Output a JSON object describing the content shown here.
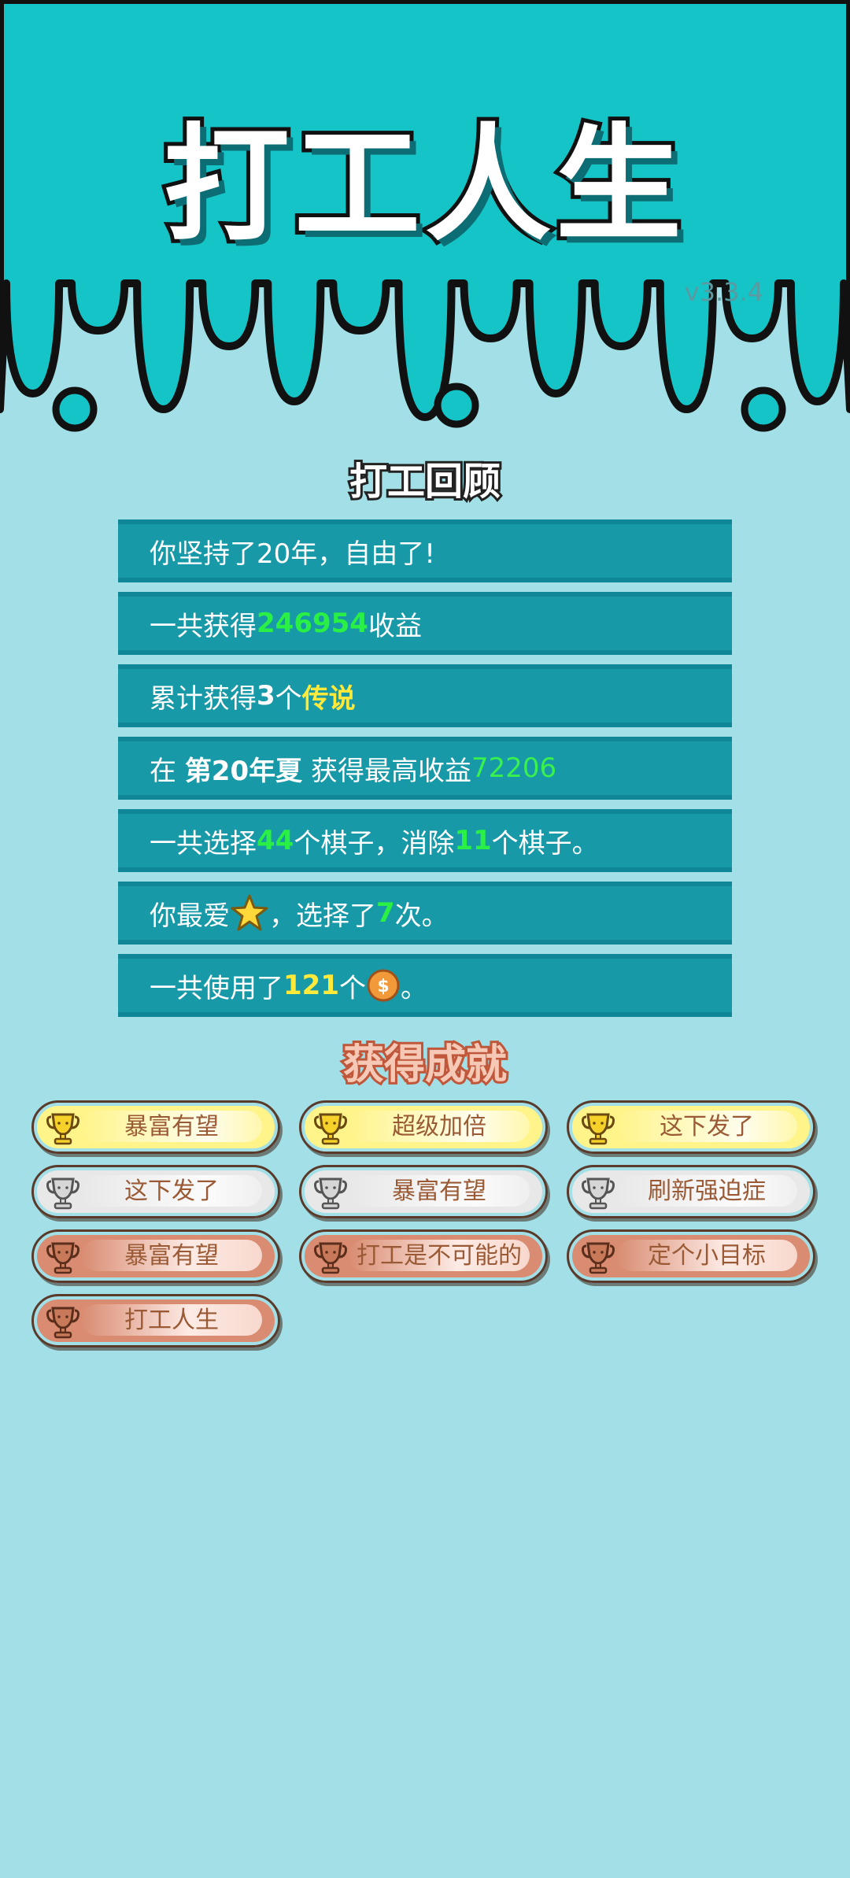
{
  "app": {
    "title": "打工人生",
    "version": "v3.3.4"
  },
  "review": {
    "heading": "打工回顾",
    "rows": [
      {
        "parts": [
          {
            "t": "你坚持了20年，自由了!",
            "c": ""
          }
        ]
      },
      {
        "parts": [
          {
            "t": "一共获得",
            "c": ""
          },
          {
            "t": "246954",
            "c": "g"
          },
          {
            "t": "收益",
            "c": ""
          }
        ]
      },
      {
        "parts": [
          {
            "t": "累计获得",
            "c": ""
          },
          {
            "t": "3",
            "c": "w"
          },
          {
            "t": "个",
            "c": ""
          },
          {
            "t": "传说",
            "c": "y"
          }
        ]
      },
      {
        "parts": [
          {
            "t": "在 ",
            "c": ""
          },
          {
            "t": "第20年夏",
            "c": "w"
          },
          {
            "t": " 获得最高收益",
            "c": ""
          },
          {
            "t": "72206",
            "c": "gl"
          }
        ]
      },
      {
        "parts": [
          {
            "t": "一共选择",
            "c": ""
          },
          {
            "t": "44",
            "c": "g"
          },
          {
            "t": "个棋子，消除",
            "c": ""
          },
          {
            "t": "11",
            "c": "g"
          },
          {
            "t": "个棋子。",
            "c": ""
          }
        ]
      },
      {
        "parts": [
          {
            "t": "你最爱",
            "c": ""
          },
          {
            "icon": "star-icon"
          },
          {
            "t": "，选择了",
            "c": ""
          },
          {
            "t": "7",
            "c": "g"
          },
          {
            "t": "次。",
            "c": ""
          }
        ]
      },
      {
        "parts": [
          {
            "t": "一共使用了",
            "c": ""
          },
          {
            "t": "121",
            "c": "y"
          },
          {
            "t": "个",
            "c": ""
          },
          {
            "icon": "coin-icon"
          },
          {
            "t": "。",
            "c": ""
          }
        ]
      }
    ]
  },
  "achievements": {
    "heading": "获得成就",
    "items": [
      {
        "label": "暴富有望",
        "tier": "gold"
      },
      {
        "label": "超级加倍",
        "tier": "gold"
      },
      {
        "label": "这下发了",
        "tier": "gold"
      },
      {
        "label": "这下发了",
        "tier": "silver"
      },
      {
        "label": "暴富有望",
        "tier": "silver"
      },
      {
        "label": "刷新强迫症",
        "tier": "silver"
      },
      {
        "label": "暴富有望",
        "tier": "bronze"
      },
      {
        "label": "打工是不可能的",
        "tier": "bronze"
      },
      {
        "label": "定个小目标",
        "tier": "bronze"
      },
      {
        "label": "打工人生",
        "tier": "bronze"
      }
    ]
  },
  "colors": {
    "header_bg": "#15c4c7",
    "page_bg": "#a2dfe6",
    "row_bg": "#1899a7",
    "gold": "#fff48a",
    "silver": "#e8e8e8",
    "bronze": "#d98c72"
  }
}
